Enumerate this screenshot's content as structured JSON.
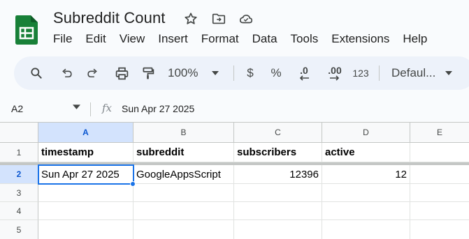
{
  "app": {
    "title": "Subreddit Count",
    "brand_color": "#188038"
  },
  "title_icons": [
    "star-icon",
    "move-to-folder-icon",
    "cloud-saved-icon"
  ],
  "menu": [
    "File",
    "Edit",
    "View",
    "Insert",
    "Format",
    "Data",
    "Tools",
    "Extensions",
    "Help"
  ],
  "toolbar": {
    "zoom": "100%",
    "currency": "$",
    "percent": "%",
    "decrease_decimal": ".0",
    "increase_decimal": ".00",
    "number_format": "123",
    "font": "Defaul..."
  },
  "formula_bar": {
    "name_box": "A2",
    "fx": "fx",
    "value": "Sun Apr 27 2025"
  },
  "columns": [
    "A",
    "B",
    "C",
    "D",
    "E"
  ],
  "rows": [
    "1",
    "2",
    "3",
    "4",
    "5"
  ],
  "sheet": {
    "headers": [
      "timestamp",
      "subreddit",
      "subscribers",
      "active"
    ],
    "data": [
      [
        "Sun Apr 27 2025",
        "GoogleAppsScript",
        "12396",
        "12"
      ]
    ]
  },
  "selection": {
    "cell": "A2",
    "accent": "#1a73e8"
  }
}
